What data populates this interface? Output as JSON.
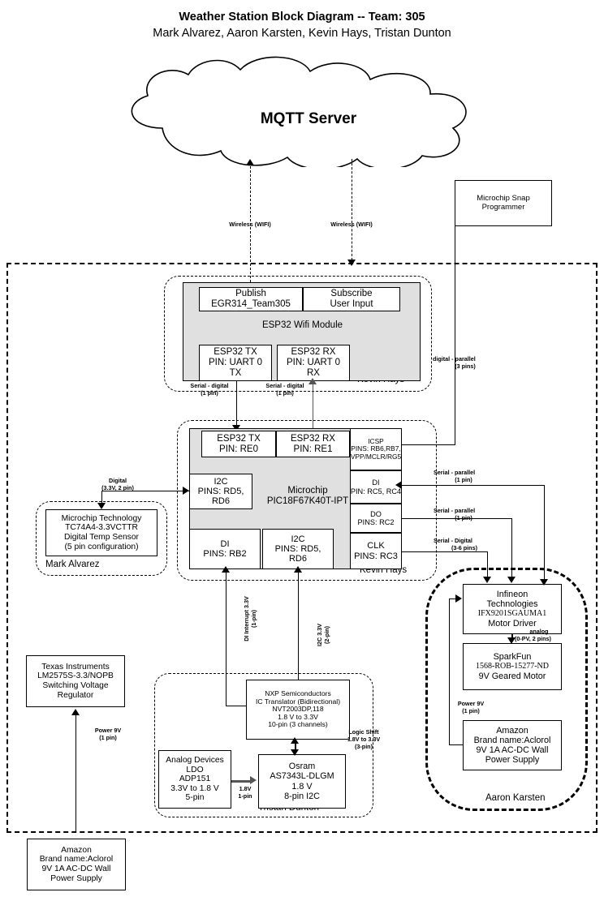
{
  "header": {
    "title": "Weather Station Block Diagram -- Team: 305",
    "subtitle": "Mark Alvarez, Aaron Karsten, Kevin Hays, Tristan Dunton"
  },
  "cloud": {
    "label": "MQTT Server"
  },
  "snap_programmer": {
    "line1": "Microchip Snap",
    "line2": "Programmer"
  },
  "wireless": {
    "left": "Wireless (WIFI)",
    "right": "Wireless (WIFI)"
  },
  "esp32": {
    "owner": "Kevin Hays",
    "module_label": "ESP32 Wifi Module",
    "publish": {
      "line1": "Publish",
      "line2": "EGR314_Team305"
    },
    "subscribe": {
      "line1": "Subscribe",
      "line2": "User Input"
    },
    "tx": {
      "line1": "ESP32 TX",
      "line2": "PIN: UART 0",
      "line3": "TX"
    },
    "rx": {
      "line1": "ESP32 RX",
      "line2": "PIN: UART 0",
      "line3": "RX"
    },
    "tx_link": {
      "l1": "Serial - digital",
      "l2": "(1 pin)"
    },
    "rx_link": {
      "l1": "Serial - digital",
      "l2": "(1 pin)"
    }
  },
  "mcu": {
    "owner": "Kevin Hays",
    "name_l1": "Microchip",
    "name_l2": "PIC18F67K40T-IPT",
    "esp_tx": {
      "l1": "ESP32 TX",
      "l2": "PIN: RE0"
    },
    "esp_rx": {
      "l1": "ESP32 RX",
      "l2": "PIN: RE1"
    },
    "icsp": {
      "l1": "ICSP",
      "l2": "PINS: RB6,RB7,",
      "l3": "VPP/MCLR/RG5"
    },
    "i2c_left": {
      "l1": "I2C",
      "l2": "PINS: RD5,",
      "l3": "RD6"
    },
    "di_bottom": {
      "l1": "DI",
      "l2": "PINS: RB2"
    },
    "i2c_bottom": {
      "l1": "I2C",
      "l2": "PINS: RD5,",
      "l3": "RD6"
    },
    "di_right": {
      "l1": "DI",
      "l2": "PIN: RC5, RC4"
    },
    "do_right": {
      "l1": "DO",
      "l2": "PINS: RC2"
    },
    "clk_right": {
      "l1": "CLK",
      "l2": "PINS: RC3"
    }
  },
  "temp_sensor": {
    "owner": "Mark Alvarez",
    "l1": "Microchip Technology",
    "l2": "TC74A4-3.3VCTTR",
    "l3": "Digital Temp Sensor",
    "l4": "(5 pin configuration)",
    "link": {
      "l1": "Digital",
      "l2": "(3.3V, 2 pin)"
    }
  },
  "regulator": {
    "l1": "Texas Instruments",
    "l2": "LM2575S-3.3/NOPB",
    "l3": "Switching Voltage",
    "l4": "Regulator",
    "link": {
      "l1": "Power 9V",
      "l2": "(1 pin)"
    }
  },
  "psu_left": {
    "l1": "Amazon",
    "l2": "Brand name:Aclorol",
    "l3": "9V 1A AC-DC Wall",
    "l4": "Power Supply"
  },
  "translator": {
    "l1": "NXP Semiconductors",
    "l2": "IC Translator (Bidirectional)",
    "l3": "NVT2003DP,118",
    "l4": "1.8 V to 3.3V",
    "l5": "10-pin (3 channels)"
  },
  "ldo": {
    "l1": "Analog Devices",
    "l2": "LDO",
    "l3": "ADP151",
    "l4": "3.3V to 1.8 V",
    "l5": "5-pin",
    "link": {
      "l1": "1.8V",
      "l2": "1-pin"
    }
  },
  "osram": {
    "owner": "Tristan Dunton",
    "l1": "Osram",
    "l2": "AS7343L-DLGM",
    "l3": "1.8 V",
    "l4": "8-pin I2C",
    "link": {
      "l1": "Logic Shift",
      "l2": "1.8V to 3.3V",
      "l3": "(3-pin)"
    }
  },
  "motor_driver": {
    "l1": "Infineon",
    "l2": "Technologies",
    "l3": "IFX9201SGAUMA1",
    "l4": "Motor Driver",
    "link": {
      "l1": "analog",
      "l2": "(0-PV, 2 pins)"
    }
  },
  "motor": {
    "l1": "SparkFun",
    "l2": "1568-ROB-15277-ND",
    "l3": "9V Geared Motor"
  },
  "psu_right": {
    "owner": "Aaron Karsten",
    "l1": "Amazon",
    "l2": "Brand name:Aclorol",
    "l3": "9V 1A AC-DC Wall",
    "l4": "Power Supply",
    "link": {
      "l1": "Power 9V",
      "l2": "(1 pin)"
    }
  },
  "links": {
    "icsp_digital": {
      "l1": "digital - parallel",
      "l2": "(3 pins)"
    },
    "di_serial": {
      "l1": "Serial - parallel",
      "l2": "(1 pin)"
    },
    "do_serial": {
      "l1": "Serial - parallel",
      "l2": "(1 pin)"
    },
    "clk_serial": {
      "l1": "Serial - Digital",
      "l2": "(3-6 pins)"
    },
    "di_interrupt": "DI Interrupt 3.3V",
    "di_interrupt_pin": "(1-pin)",
    "i2c_33": "I2C 3.3V",
    "i2c_33_pin": "(2-pin)"
  },
  "colors": {
    "fill": "#e0e0e0",
    "stroke": "#000000"
  }
}
